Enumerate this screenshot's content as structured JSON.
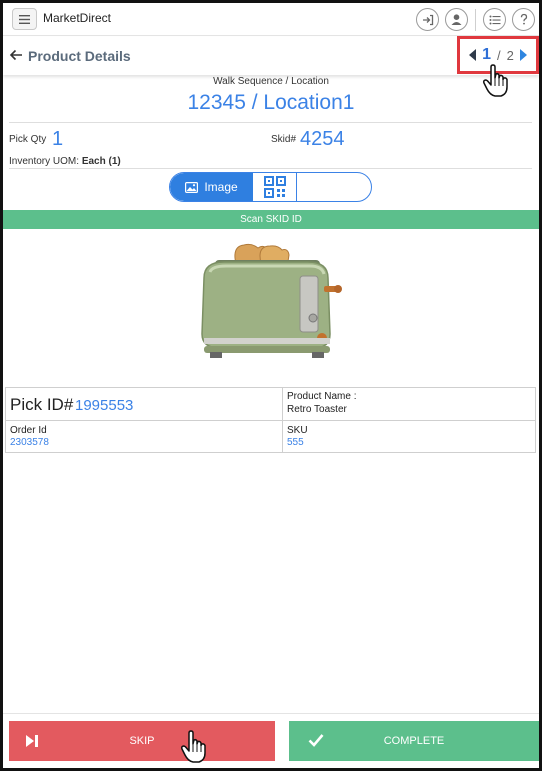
{
  "app": {
    "title": "MarketDirect"
  },
  "top_icons": [
    "login-icon",
    "user-icon",
    "list-icon",
    "help-icon"
  ],
  "header": {
    "title": "Product Details",
    "pager": {
      "current": "1",
      "separator": "/",
      "total": "2"
    }
  },
  "location": {
    "label": "Walk Sequence / Location",
    "value": "12345 / Location1"
  },
  "pick": {
    "qty_label": "Pick Qty",
    "qty_value": "1",
    "skid_label": "Skid#",
    "skid_value": "4254",
    "uom_label": "Inventory UOM:",
    "uom_value": "Each (1)"
  },
  "toggle": {
    "image_label": "Image"
  },
  "scan_bar": "Scan SKID ID",
  "details": {
    "pick_id_label": "Pick ID#",
    "pick_id_value": "1995553",
    "product_name_label": "Product Name :",
    "product_name_value": "Retro Toaster",
    "order_id_label": "Order Id",
    "order_id_value": "2303578",
    "sku_label": "SKU",
    "sku_value": "555"
  },
  "footer": {
    "skip_label": "SKIP",
    "complete_label": "COMPLETE"
  },
  "colors": {
    "accent_blue": "#3b82e6",
    "green": "#5cbf8c",
    "red": "#e35a5f",
    "highlight": "#e0383e"
  }
}
